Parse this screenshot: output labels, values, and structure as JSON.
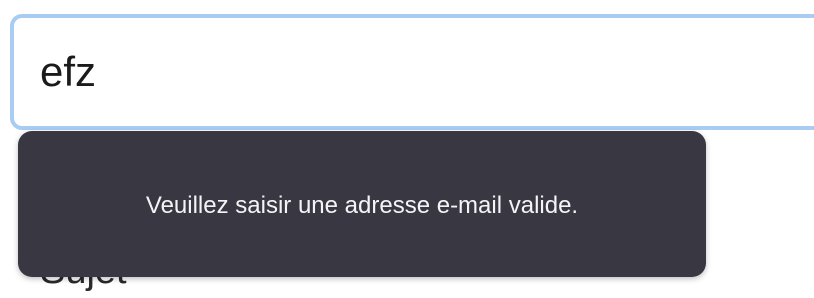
{
  "form": {
    "email_value": "efz",
    "subject_label": "Sujet"
  },
  "validation": {
    "message": "Veuillez saisir une adresse e-mail valide."
  },
  "colors": {
    "focus_ring": "#a9ccf3",
    "tooltip_background": "#393842",
    "tooltip_text": "#f4f4f6"
  }
}
